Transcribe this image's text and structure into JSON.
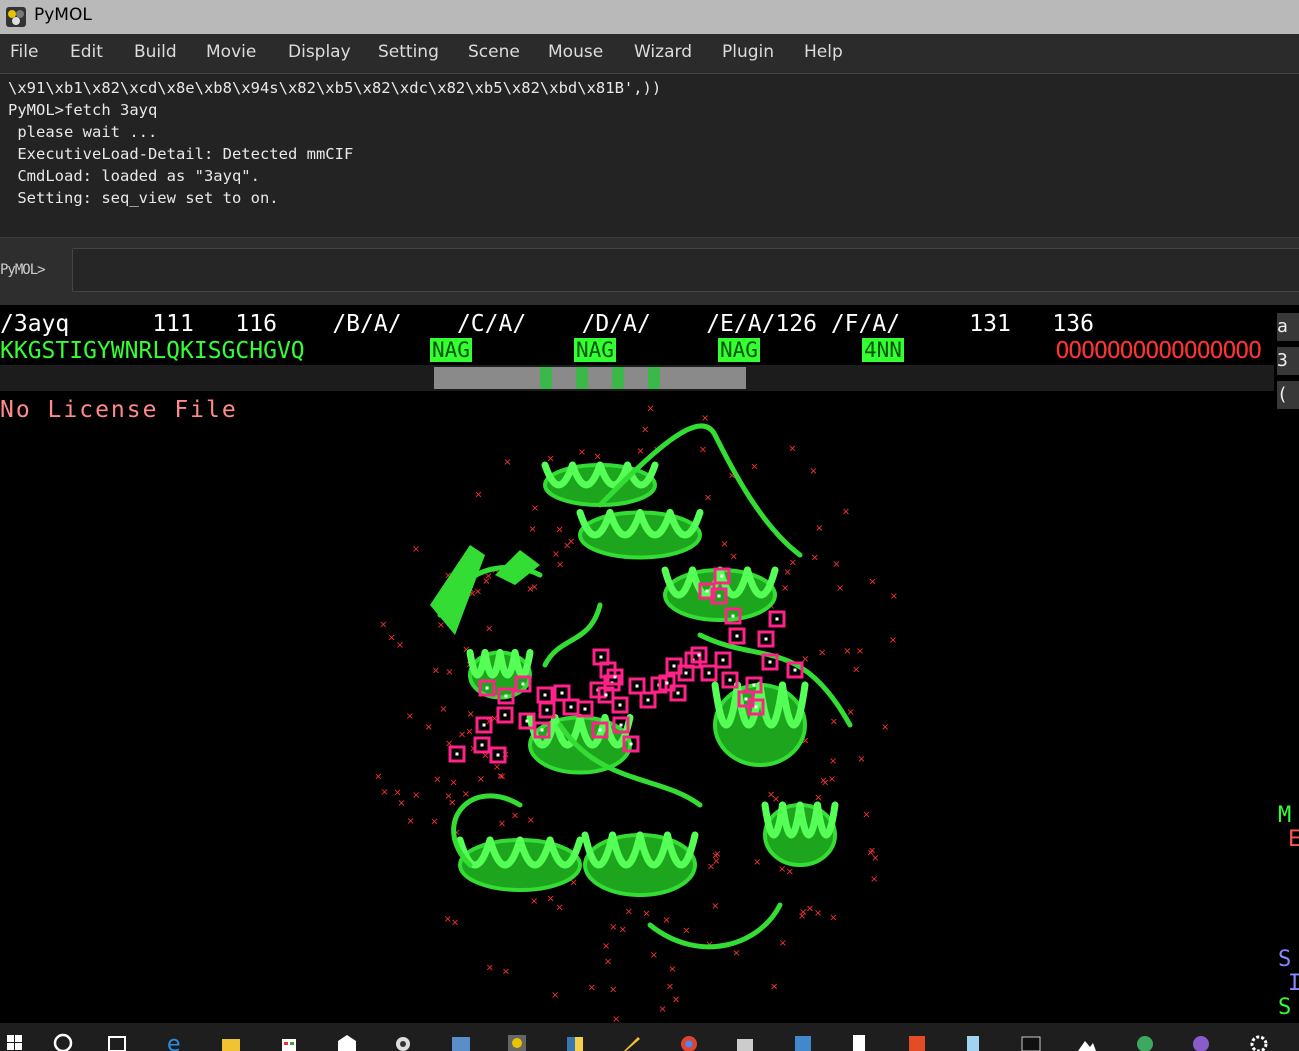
{
  "window": {
    "title": "PyMOL",
    "icon": "pymol-logo-icon"
  },
  "menubar": {
    "items": [
      "File",
      "Edit",
      "Build",
      "Movie",
      "Display",
      "Setting",
      "Scene",
      "Mouse",
      "Wizard",
      "Plugin",
      "Help"
    ]
  },
  "console": {
    "lines": [
      "\\x91\\xb1\\x82\\xcd\\x8e\\xb8\\x94s\\x82\\xb5\\x82\\xdc\\x82\\xb5\\x82\\xbd\\x81B',))",
      "PyMOL>fetch 3ayq",
      " please wait ...",
      " ExecutiveLoad-Detail: Detected mmCIF",
      " CmdLoad: loaded as \"3ayq\".",
      " Setting: seq_view set to on."
    ]
  },
  "command": {
    "prompt": "PyMOL>",
    "value": ""
  },
  "sequence": {
    "header": "/3ayq      111   116    /B/A/    /C/A/    /D/A/    /E/A/126 /F/A/     131   136",
    "residues": "KKGSTIGYWNRLQKISGCHGVQ",
    "tags": [
      "NAG",
      "NAG",
      "NAG",
      "4NN"
    ],
    "water": "OOOOOOOOOOOOOOOO"
  },
  "viewer": {
    "license_text": "No License File",
    "protein_color": "#33dd33",
    "ligand_color": "#ff2288",
    "water_color": "#ff3333"
  },
  "side_panel": {
    "buttons": [
      "a",
      "3",
      "("
    ],
    "text_m": "M",
    "text_e": "E",
    "text_s": "S",
    "text_i": "I",
    "text_s2": "S"
  },
  "taskbar": {
    "icons": [
      "windows-start-icon",
      "search-icon",
      "task-view-icon",
      "edge-icon",
      "file-explorer-icon",
      "store-icon",
      "mail-icon",
      "media-icon",
      "app-icon",
      "pymol-taskbar-icon",
      "python-icon",
      "pen-icon",
      "chrome-icon",
      "mail-app-icon",
      "settings-app-icon",
      "document-icon",
      "git-icon",
      "notepad-icon",
      "terminal-icon",
      "photos-icon",
      "molecule-icon",
      "github-icon",
      "gear-icon"
    ]
  }
}
